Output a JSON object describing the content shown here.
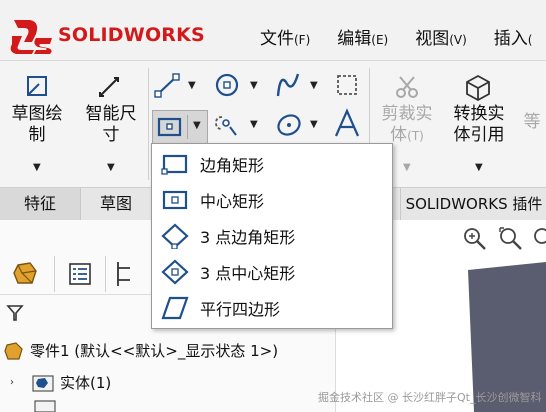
{
  "app": {
    "logo_ds": "3DS",
    "logo_solid": "SOLID",
    "logo_works": "WORKS"
  },
  "menu": [
    {
      "label": "文件",
      "hotkey": "(F)"
    },
    {
      "label": "编辑",
      "hotkey": "(E)"
    },
    {
      "label": "视图",
      "hotkey": "(V)"
    },
    {
      "label": "插入",
      "hotkey": "("
    }
  ],
  "ribbon": {
    "sketch_label": "草图绘\n制",
    "smart_dim_label": "智能尺\n寸",
    "trim_label": "剪裁实\n体",
    "trim_hotkey": "(T)",
    "convert_label": "转换实\n体引用",
    "equal_label": "等"
  },
  "tabs": [
    {
      "label": "特征"
    },
    {
      "label": "草图"
    },
    {
      "label": "SOLIDWORKS 插件"
    }
  ],
  "rect_menu": {
    "items": [
      {
        "label": "边角矩形",
        "icon": "corner-rectangle-icon"
      },
      {
        "label": "中心矩形",
        "icon": "center-rectangle-icon"
      },
      {
        "label": "3 点边角矩形",
        "icon": "3-point-corner-rectangle-icon"
      },
      {
        "label": "3 点中心矩形",
        "icon": "3-point-center-rectangle-icon"
      },
      {
        "label": "平行四边形",
        "icon": "parallelogram-icon"
      }
    ]
  },
  "tree": {
    "part_label": "零件1 (默认<<默认>_显示状态 1>)",
    "solid_bodies_label": "实体(1)"
  },
  "watermark": "掘金技术社区 @ 长沙红胖子Qt_长沙创微智科",
  "colors": {
    "brand_red": "#d21a1a",
    "icon_blue": "#1f4f8c",
    "body_gray": "#5a5c6f"
  }
}
